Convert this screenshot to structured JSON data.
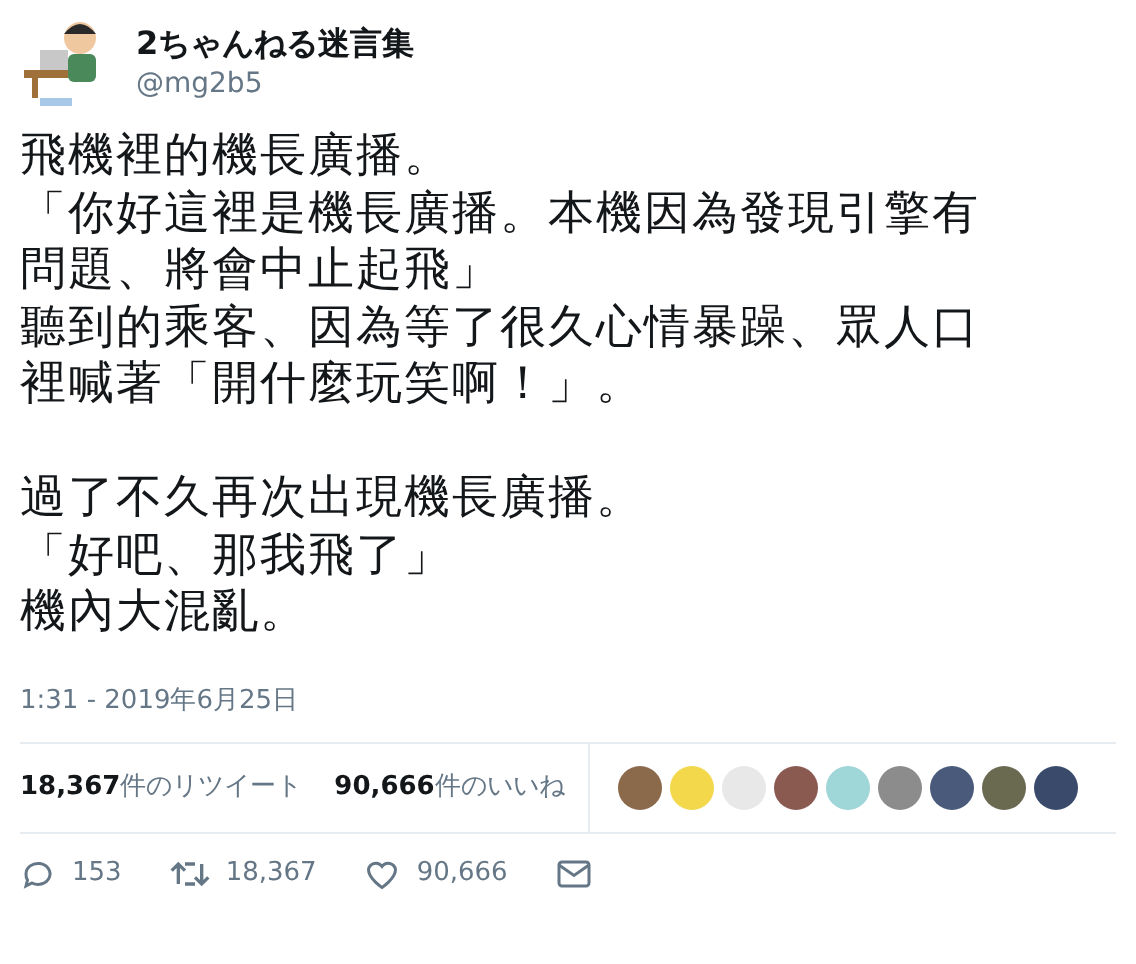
{
  "author": {
    "name": "2ちゃんねる迷言集",
    "handle": "@mg2b5"
  },
  "body": {
    "paragraphs": [
      {
        "lines": [
          "飛機裡的機長廣播。",
          "「你好這裡是機長廣播。本機因為發現引擎有",
          "問題、將會中止起飛」",
          "聽到的乘客、因為等了很久心情暴躁、眾人口",
          "裡喊著「開什麼玩笑啊！」。"
        ]
      },
      {
        "lines": [
          "過了不久再次出現機長廣播。",
          "「好吧、那我飛了」",
          "機內大混亂。"
        ]
      }
    ]
  },
  "timestamp": "1:31 - 2019年6月25日",
  "stats": {
    "retweets": {
      "count": "18,367",
      "label": "件のリツイート"
    },
    "likes": {
      "count": "90,666",
      "label": "件のいいね"
    }
  },
  "likers": [
    {
      "color": "#8a6a4a"
    },
    {
      "color": "#f2d84a"
    },
    {
      "color": "#e8e8e8"
    },
    {
      "color": "#8a5a50"
    },
    {
      "color": "#9fd6d8"
    },
    {
      "color": "#8c8c8c"
    },
    {
      "color": "#4a5a7a"
    },
    {
      "color": "#6a6a50"
    },
    {
      "color": "#3a4a6a"
    }
  ],
  "actions": {
    "replies": "153",
    "retweets": "18,367",
    "likes": "90,666"
  }
}
